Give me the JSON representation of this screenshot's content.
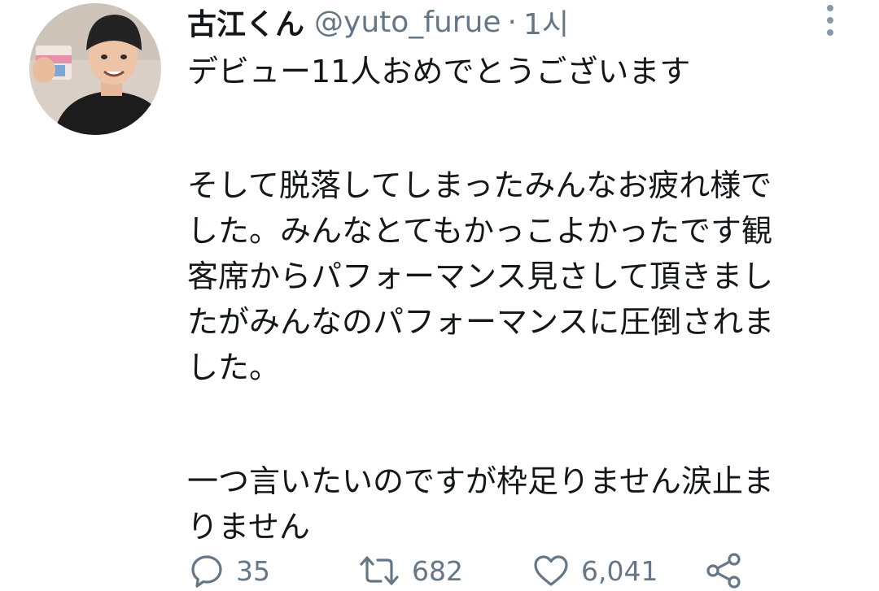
{
  "tweet": {
    "display_name": "古江くん",
    "handle": "@yuto_furue",
    "separator": "·",
    "time": "1시",
    "lines": [
      "デビュー11人おめでとうございます",
      "",
      "そして脱落してしまったみんなお疲れ様で",
      "した。みんなとてもかっこよかったです観",
      "客席からパフォーマンス見さして頂きまし",
      "たがみんなのパフォーマンスに圧倒されま",
      "した。",
      "",
      "一つ言いたいのですが枠足りません涙止ま",
      "りません"
    ]
  },
  "actions": {
    "reply": {
      "icon": "reply-icon",
      "count": "35"
    },
    "retweet": {
      "icon": "retweet-icon",
      "count": "682"
    },
    "like": {
      "icon": "heart-icon",
      "count": "6,041"
    },
    "share": {
      "icon": "share-icon"
    }
  },
  "colors": {
    "text": "#14171a",
    "secondary": "#657786",
    "icon_gray": "#657786"
  }
}
